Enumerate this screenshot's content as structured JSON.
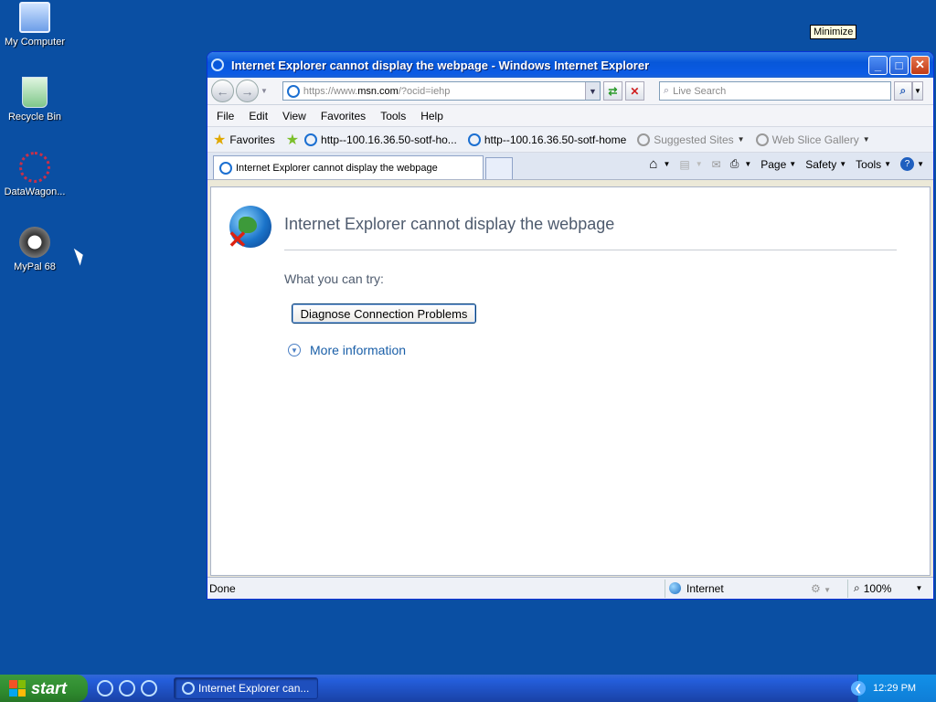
{
  "desktop": {
    "icons": [
      {
        "label": "My Computer"
      },
      {
        "label": "Recycle Bin"
      },
      {
        "label": "DataWagon..."
      },
      {
        "label": "MyPal 68"
      }
    ],
    "tooltip": "Minimize"
  },
  "window": {
    "title": "Internet Explorer cannot display the webpage - Windows Internet Explorer",
    "address_prefix": "https://www.",
    "address_domain": "msn.com",
    "address_suffix": "/?ocid=iehp",
    "search_placeholder": "Live Search",
    "menu": [
      "File",
      "Edit",
      "View",
      "Favorites",
      "Tools",
      "Help"
    ],
    "favorites_label": "Favorites",
    "favorites": [
      {
        "label": "http--100.16.36.50-sotf-ho..."
      },
      {
        "label": "http--100.16.36.50-sotf-home"
      },
      {
        "label": "Suggested Sites"
      },
      {
        "label": "Web Slice Gallery"
      }
    ],
    "tab_label": "Internet Explorer cannot display the webpage",
    "commands": {
      "page": "Page",
      "safety": "Safety",
      "tools": "Tools"
    },
    "page": {
      "heading": "Internet Explorer cannot display the webpage",
      "try_label": "What you can try:",
      "diagnose_button": "Diagnose Connection Problems",
      "more_info": "More information"
    },
    "status": {
      "text": "Done",
      "zone": "Internet",
      "zoom": "100%"
    }
  },
  "taskbar": {
    "start": "start",
    "task_label": "Internet Explorer can...",
    "clock": "12:29 PM"
  }
}
